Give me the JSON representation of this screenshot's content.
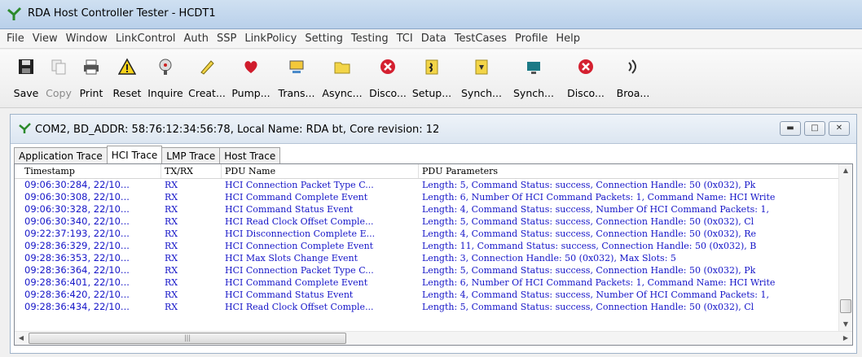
{
  "window": {
    "title": "RDA Host Controller Tester - HCDT1"
  },
  "menu": [
    "File",
    "View",
    "Window",
    "LinkControl",
    "Auth",
    "SSP",
    "LinkPolicy",
    "Setting",
    "Testing",
    "TCI",
    "Data",
    "TestCases",
    "Profile",
    "Help"
  ],
  "toolbar": [
    {
      "label": "Save",
      "icon": "floppy-disk-icon",
      "enabled": true
    },
    {
      "label": "Copy",
      "icon": "copy-icon",
      "enabled": false
    },
    {
      "label": "Print",
      "icon": "printer-icon",
      "enabled": true
    },
    {
      "label": "Reset",
      "icon": "warning-icon",
      "enabled": true
    },
    {
      "label": "Inquire",
      "icon": "satellite-dish-icon",
      "enabled": true
    },
    {
      "label": "Creat...",
      "icon": "pencil-icon",
      "enabled": true
    },
    {
      "label": "Pump...",
      "icon": "heart-icon",
      "enabled": true
    },
    {
      "label": "Trans...",
      "icon": "transfer-icon",
      "enabled": true
    },
    {
      "label": "Async...",
      "icon": "folder-icon",
      "enabled": true
    },
    {
      "label": "Disco...",
      "icon": "disconnect-icon",
      "enabled": true
    },
    {
      "label": "Setup...",
      "icon": "setup-icon",
      "enabled": true
    },
    {
      "label": "Synch...",
      "icon": "sync-doc-icon",
      "enabled": true
    },
    {
      "label": "Synch...",
      "icon": "sync-monitor-icon",
      "enabled": true
    },
    {
      "label": "Disco...",
      "icon": "disconnect-icon",
      "enabled": true
    },
    {
      "label": "Broa...",
      "icon": "broadcast-icon",
      "enabled": true
    }
  ],
  "child_window": {
    "title": "COM2, BD_ADDR: 58:76:12:34:56:78, Local Name: RDA bt, Core revision: 12",
    "tabs": [
      "Application Trace",
      "HCI Trace",
      "LMP Trace",
      "Host Trace"
    ],
    "active_tab": "HCI Trace",
    "columns": [
      "Timestamp",
      "TX/RX",
      "PDU Name",
      "PDU Parameters"
    ],
    "rows": [
      [
        "09:06:30:284,  22/10...",
        "RX",
        "HCI Connection Packet Type C...",
        "Length: 5, Command Status: success, Connection Handle: 50 (0x032), Pk"
      ],
      [
        "09:06:30:308,  22/10...",
        "RX",
        "HCI Command Complete Event",
        "Length: 6, Number Of HCI Command Packets: 1, Command Name: HCI Write"
      ],
      [
        "09:06:30:328,  22/10...",
        "RX",
        "HCI Command Status Event",
        "Length: 4, Command Status: success, Number Of HCI Command Packets: 1,"
      ],
      [
        "09:06:30:340,  22/10...",
        "RX",
        "HCI Read Clock Offset Comple...",
        "Length: 5, Command Status: success, Connection Handle: 50 (0x032), Cl"
      ],
      [
        "09:22:37:193,  22/10...",
        "RX",
        "HCI Disconnection Complete E...",
        "Length: 4, Command Status: success, Connection Handle: 50 (0x032), Re"
      ],
      [
        "09:28:36:329,  22/10...",
        "RX",
        "HCI Connection Complete Event",
        "Length: 11, Command Status: success, Connection Handle: 50 (0x032), B"
      ],
      [
        "09:28:36:353,  22/10...",
        "RX",
        "HCI Max Slots Change Event",
        "Length: 3, Connection Handle: 50 (0x032), Max Slots: 5"
      ],
      [
        "09:28:36:364,  22/10...",
        "RX",
        "HCI Connection Packet Type C...",
        "Length: 5, Command Status: success, Connection Handle: 50 (0x032), Pk"
      ],
      [
        "09:28:36:401,  22/10...",
        "RX",
        "HCI Command Complete Event",
        "Length: 6, Number Of HCI Command Packets: 1, Command Name: HCI Write"
      ],
      [
        "09:28:36:420,  22/10...",
        "RX",
        "HCI Command Status Event",
        "Length: 4, Command Status: success, Number Of HCI Command Packets: 1,"
      ],
      [
        "09:28:36:434,  22/10...",
        "RX",
        "HCI Read Clock Offset Comple...",
        "Length: 5, Command Status: success, Connection Handle: 50 (0x032), Cl"
      ]
    ]
  },
  "colors": {
    "row_text": "#1616c8",
    "title_bar": "#c5daf0"
  }
}
